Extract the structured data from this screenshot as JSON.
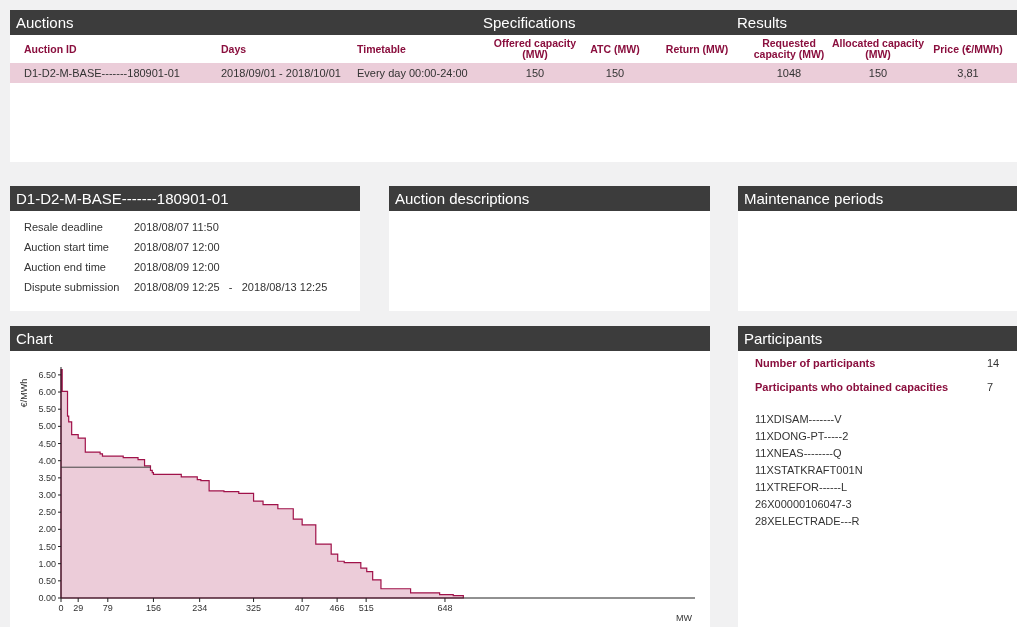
{
  "auctions": {
    "title": "Auctions",
    "group_headers": [
      "Specifications",
      "Results"
    ],
    "columns": [
      "Auction ID",
      "Days",
      "Timetable",
      "Offered capacity (MW)",
      "ATC (MW)",
      "Return (MW)",
      "Requested capacity (MW)",
      "Allocated capacity (MW)",
      "Price (€/MWh)"
    ],
    "rows": [
      {
        "selected": true,
        "cells": [
          "D1-D2-M-BASE-------180901-01",
          "2018/09/01 - 2018/10/01",
          "Every day 00:00-24:00",
          "150",
          "150",
          "",
          "1048",
          "150",
          "3,81"
        ]
      }
    ]
  },
  "details": {
    "title": "D1-D2-M-BASE-------180901-01",
    "rows": [
      {
        "label": "Resale deadline",
        "value": "2018/08/07 11:50"
      },
      {
        "label": "Auction start time",
        "value": "2018/08/07 12:00"
      },
      {
        "label": "Auction end time",
        "value": "2018/08/09 12:00"
      },
      {
        "label": "Dispute submission",
        "value": "2018/08/09 12:25",
        "separator": "-",
        "value_end": "2018/08/13 12:25"
      }
    ]
  },
  "descriptions": {
    "title": "Auction descriptions"
  },
  "maintenance": {
    "title": "Maintenance periods"
  },
  "chart": {
    "title": "Chart",
    "chart_data": {
      "type": "area",
      "ylabel": "€/MWh",
      "xlabel": "MW",
      "xlim": [
        0,
        1070
      ],
      "ylim": [
        0,
        6.7
      ],
      "xticks": [
        0,
        29,
        79,
        156,
        234,
        325,
        407,
        466,
        515,
        648
      ],
      "yticks": [
        {
          "value": 0,
          "label": "0.00"
        },
        {
          "value": 0.5,
          "label": "0.50"
        },
        {
          "value": 1,
          "label": "1.00"
        },
        {
          "value": 1.5,
          "label": "1.50"
        },
        {
          "value": 2,
          "label": "2.00"
        },
        {
          "value": 2.5,
          "label": "2.50"
        },
        {
          "value": 3,
          "label": "3.00"
        },
        {
          "value": 3.5,
          "label": "3.50"
        },
        {
          "value": 4,
          "label": "4.00"
        },
        {
          "value": 4.5,
          "label": "4.50"
        },
        {
          "value": 5,
          "label": "5.00"
        },
        {
          "value": 5.5,
          "label": "5.50"
        },
        {
          "value": 6,
          "label": "6.00"
        },
        {
          "value": 6.5,
          "label": "6.50"
        }
      ],
      "x": [
        0,
        2,
        2,
        11,
        11,
        13,
        13,
        18,
        18,
        29,
        29,
        41,
        41,
        66,
        66,
        70,
        70,
        105,
        105,
        130,
        130,
        141,
        141,
        151,
        151,
        154,
        154,
        156,
        156,
        203,
        203,
        230,
        230,
        236,
        236,
        250,
        250,
        275,
        275,
        300,
        300,
        325,
        325,
        341,
        341,
        366,
        366,
        392,
        392,
        407,
        407,
        430,
        430,
        456,
        456,
        467,
        467,
        478,
        478,
        506,
        506,
        516,
        516,
        526,
        526,
        540,
        540,
        590,
        590,
        639,
        639,
        662,
        662,
        679,
        679
      ],
      "series": [
        {
          "color": "#a0124a",
          "values": [
            6.65,
            6.65,
            6.02,
            6.02,
            5.3,
            5.3,
            5.13,
            5.13,
            4.76,
            4.76,
            4.66,
            4.66,
            4.25,
            4.25,
            4.2,
            4.2,
            4.13,
            4.13,
            4.09,
            4.09,
            4.03,
            4.03,
            3.85,
            3.85,
            3.72,
            3.72,
            3.65,
            3.65,
            3.6,
            3.6,
            3.53,
            3.53,
            3.45,
            3.45,
            3.42,
            3.42,
            3.12,
            3.12,
            3.1,
            3.1,
            3.05,
            3.05,
            2.82,
            2.82,
            2.72,
            2.72,
            2.6,
            2.6,
            2.3,
            2.3,
            2.13,
            2.13,
            1.57,
            1.57,
            1.28,
            1.28,
            1.07,
            1.07,
            1.03,
            1.03,
            0.87,
            0.87,
            0.77,
            0.77,
            0.53,
            0.53,
            0.27,
            0.27,
            0.15,
            0.15,
            0.1,
            0.1,
            0.07,
            0.07,
            0
          ]
        }
      ],
      "ref_lines": [
        {
          "axis": "y",
          "value": 3.81
        }
      ]
    }
  },
  "participants": {
    "title": "Participants",
    "stats": [
      {
        "label": "Number of participants",
        "value": "14"
      },
      {
        "label": "Participants who obtained capacities",
        "value": "7"
      }
    ],
    "list": [
      "11XDISAM-------V",
      "11XDONG-PT-----2",
      "11XNEAS--------Q",
      "11XSTATKRAFT001N",
      "11XTREFOR------L",
      "26X00000106047-3",
      "28XELECTRADE---R"
    ]
  }
}
